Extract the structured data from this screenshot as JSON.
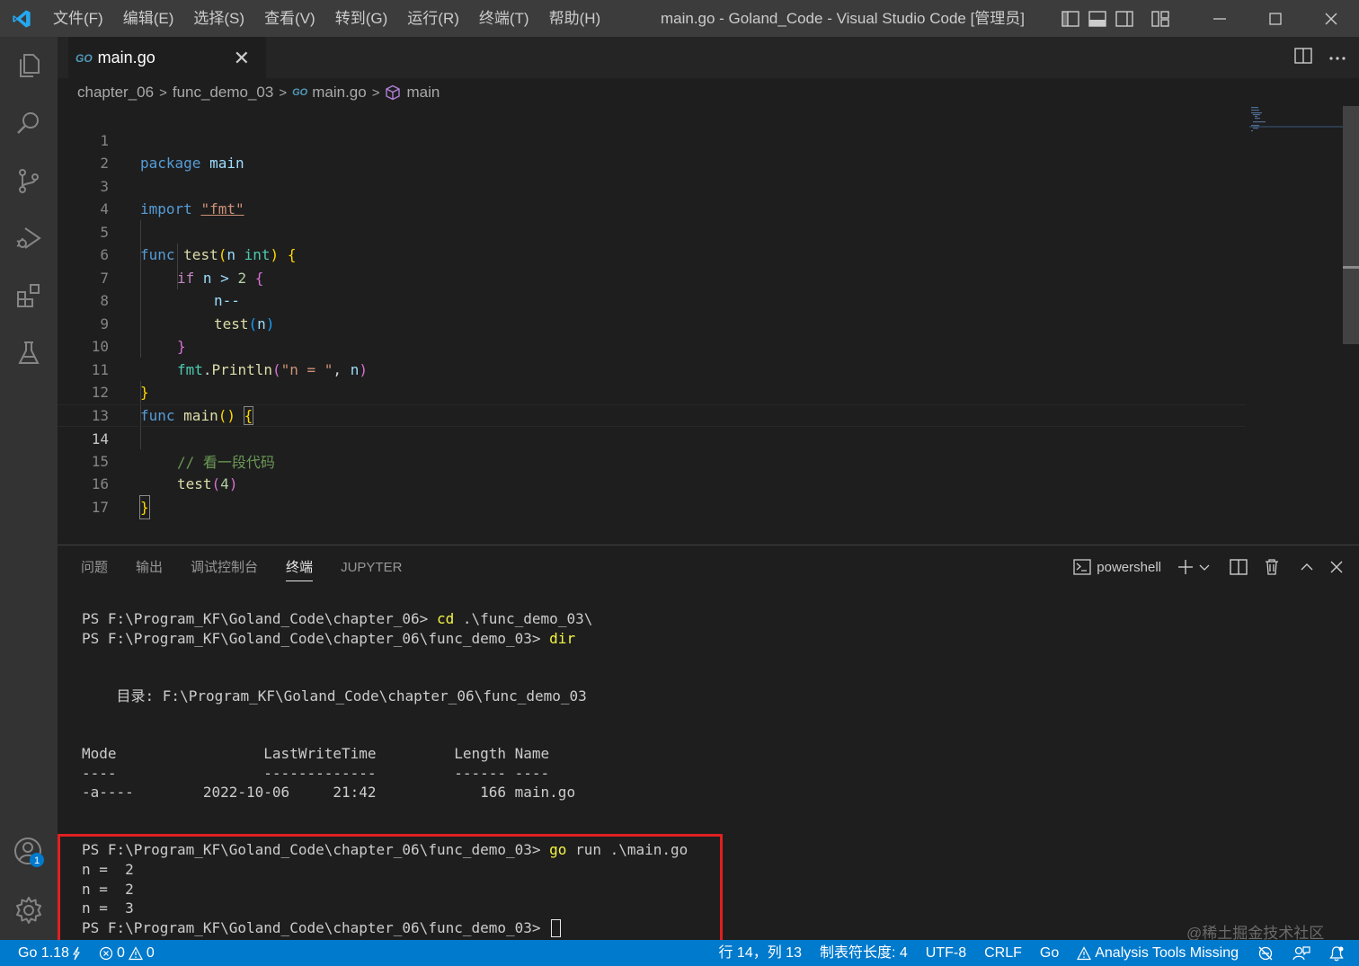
{
  "titlebar": {
    "menu": [
      "文件(F)",
      "编辑(E)",
      "选择(S)",
      "查看(V)",
      "转到(G)",
      "运行(R)",
      "终端(T)",
      "帮助(H)"
    ],
    "title": "main.go - Goland_Code - Visual Studio Code [管理员]"
  },
  "tab": {
    "badge": "GO",
    "label": "main.go",
    "close": "✕"
  },
  "breadcrumb": {
    "folder1": "chapter_06",
    "folder2": "func_demo_03",
    "file_badge": "GO",
    "file": "main.go",
    "symbol": "main"
  },
  "editor": {
    "current_line": 14,
    "line_numbers": [
      "1",
      "2",
      "3",
      "4",
      "5",
      "6",
      "7",
      "8",
      "9",
      "10",
      "11",
      "12",
      "13",
      "14",
      "15",
      "16",
      "17"
    ],
    "l1": {
      "kw": "package",
      "id": "main"
    },
    "l3": {
      "kw": "import",
      "str": "\"fmt\""
    },
    "l5": {
      "kw": "func",
      "fn": "test",
      "open": "(",
      "param": "n",
      "type": "int",
      "close": ")",
      "brace": "{"
    },
    "l6": {
      "kw": "if",
      "cond": "n > ",
      "num": "2",
      "brace": "{"
    },
    "l7": {
      "stmt": "n--"
    },
    "l8": {
      "fn": "test",
      "open": "(",
      "arg": "n",
      "close": ")"
    },
    "l9": {
      "brace": "}"
    },
    "l10": {
      "pkg": "fmt",
      "dot": ".",
      "fn": "Println",
      "open": "(",
      "str": "\"n = \"",
      "sep": ", ",
      "arg": "n",
      "close": ")"
    },
    "l11": {
      "brace": "}"
    },
    "l12": {
      "kw": "func",
      "fn": "main",
      "parens": "()",
      "brace": "{"
    },
    "l14": {
      "comment": "// 看一段代码"
    },
    "l15": {
      "fn": "test",
      "open": "(",
      "num": "4",
      "close": ")"
    },
    "l16": {
      "brace": "}"
    }
  },
  "panel": {
    "tabs": [
      "问题",
      "输出",
      "调试控制台",
      "终端",
      "JUPYTER"
    ],
    "active_tab": "终端",
    "shell": "powershell"
  },
  "terminal": {
    "l1_prompt": "PS F:\\Program_KF\\Goland_Code\\chapter_06> ",
    "l1_cmd": "cd",
    "l1_arg": " .\\func_demo_03\\",
    "l2_prompt": "PS F:\\Program_KF\\Goland_Code\\chapter_06\\func_demo_03> ",
    "l2_cmd": "dir",
    "dir_header": "    目录: F:\\Program_KF\\Goland_Code\\chapter_06\\func_demo_03",
    "cols": "Mode                 LastWriteTime         Length Name",
    "dashes": "----                 -------------         ------ ----",
    "file_row": "-a----        2022-10-06     21:42            166 main.go",
    "l3_prompt": "PS F:\\Program_KF\\Goland_Code\\chapter_06\\func_demo_03> ",
    "l3_cmd": "go",
    "l3_arg": " run .\\main.go",
    "out1": "n =  2",
    "out2": "n =  2",
    "out3": "n =  3",
    "l4_prompt": "PS F:\\Program_KF\\Goland_Code\\chapter_06\\func_demo_03> "
  },
  "watermark": "@稀土掘金技术社区",
  "statusbar": {
    "go_version": "Go 1.18",
    "errors": "0",
    "warnings": "0",
    "position": "行 14，列 13",
    "tab_size": "制表符长度: 4",
    "encoding": "UTF-8",
    "eol": "CRLF",
    "language": "Go",
    "analysis": "Analysis Tools Missing"
  },
  "accounts_badge": "1",
  "colors": {
    "accent": "#007acc",
    "highlight_box": "#e02020",
    "activity_bar": "#333333",
    "title_bar": "#3c3c3c"
  }
}
